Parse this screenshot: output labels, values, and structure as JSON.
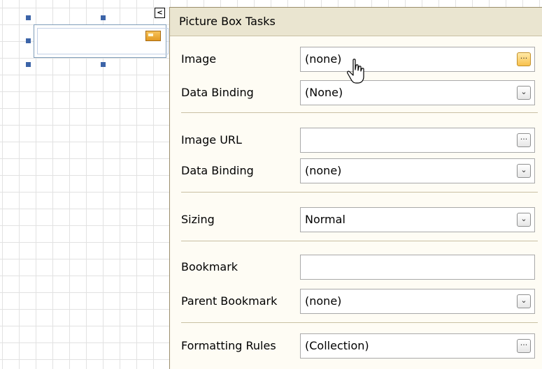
{
  "panel": {
    "title": "Picture Box Tasks",
    "smart_tag_glyph": "<",
    "rows": [
      {
        "label": "Image",
        "value": "(none)",
        "button": "ellipsis"
      },
      {
        "label": "Data Binding",
        "value": "(None)",
        "button": "dropdown"
      },
      {
        "label": "Image URL",
        "value": "",
        "button": "ellipsis"
      },
      {
        "label": "Data Binding",
        "value": "(none)",
        "button": "dropdown"
      },
      {
        "label": "Sizing",
        "value": "Normal",
        "button": "dropdown"
      },
      {
        "label": "Bookmark",
        "value": "",
        "button": "none"
      },
      {
        "label": "Parent Bookmark",
        "value": "(none)",
        "button": "dropdown"
      },
      {
        "label": "Formatting Rules",
        "value": "(Collection)",
        "button": "ellipsis"
      }
    ],
    "ellipsis_glyph": "···",
    "dropdown_glyph": "⌄"
  },
  "colors": {
    "panel_bg": "#fefcf4",
    "header_bg": "#eae5d0",
    "hover_button": "#f8c14d",
    "selection_handle": "#3c64a8"
  },
  "icons": [
    "image-icon",
    "smart-tag-icon",
    "ellipsis-icon",
    "dropdown-arrow-icon",
    "hand-pointer-cursor-icon"
  ]
}
